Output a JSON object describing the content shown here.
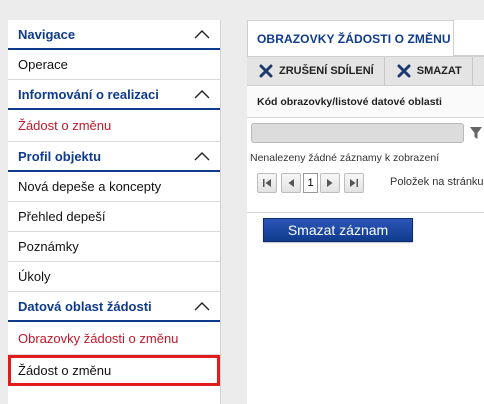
{
  "sidebar": {
    "sections": [
      {
        "title": "Navigace",
        "items": [
          {
            "label": "Operace"
          }
        ]
      },
      {
        "title": "Informování o realizaci",
        "items": [
          {
            "label": "Žádost o změnu"
          }
        ]
      },
      {
        "title": "Profil objektu",
        "items": [
          {
            "label": "Nová depeše a koncepty"
          },
          {
            "label": "Přehled depeší"
          },
          {
            "label": "Poznámky"
          },
          {
            "label": "Úkoly"
          }
        ]
      },
      {
        "title": "Datová oblast žádosti",
        "items": [
          {
            "label": "Obrazovky žádosti o změnu"
          },
          {
            "label": "Žádost o změnu"
          }
        ]
      }
    ]
  },
  "main": {
    "tab_label": "OBRAZOVKY ŽÁDOSTI O ZMĚNU",
    "toolbar": {
      "cancel_share_label": "ZRUŠENÍ SDÍLENÍ",
      "delete_label": "SMAZAT"
    },
    "table": {
      "column_header": "Kód obrazovky/listové datové oblasti",
      "empty_message": "Nenalezeny žádné záznamy k zobrazení"
    },
    "pager": {
      "page": "1",
      "per_page_label": "Položek na stránku"
    },
    "delete_record_label": "Smazat záznam"
  },
  "colors": {
    "accent": "#0f3b8c",
    "active_link": "#c0182a",
    "highlight_box": "#e21c1c"
  }
}
